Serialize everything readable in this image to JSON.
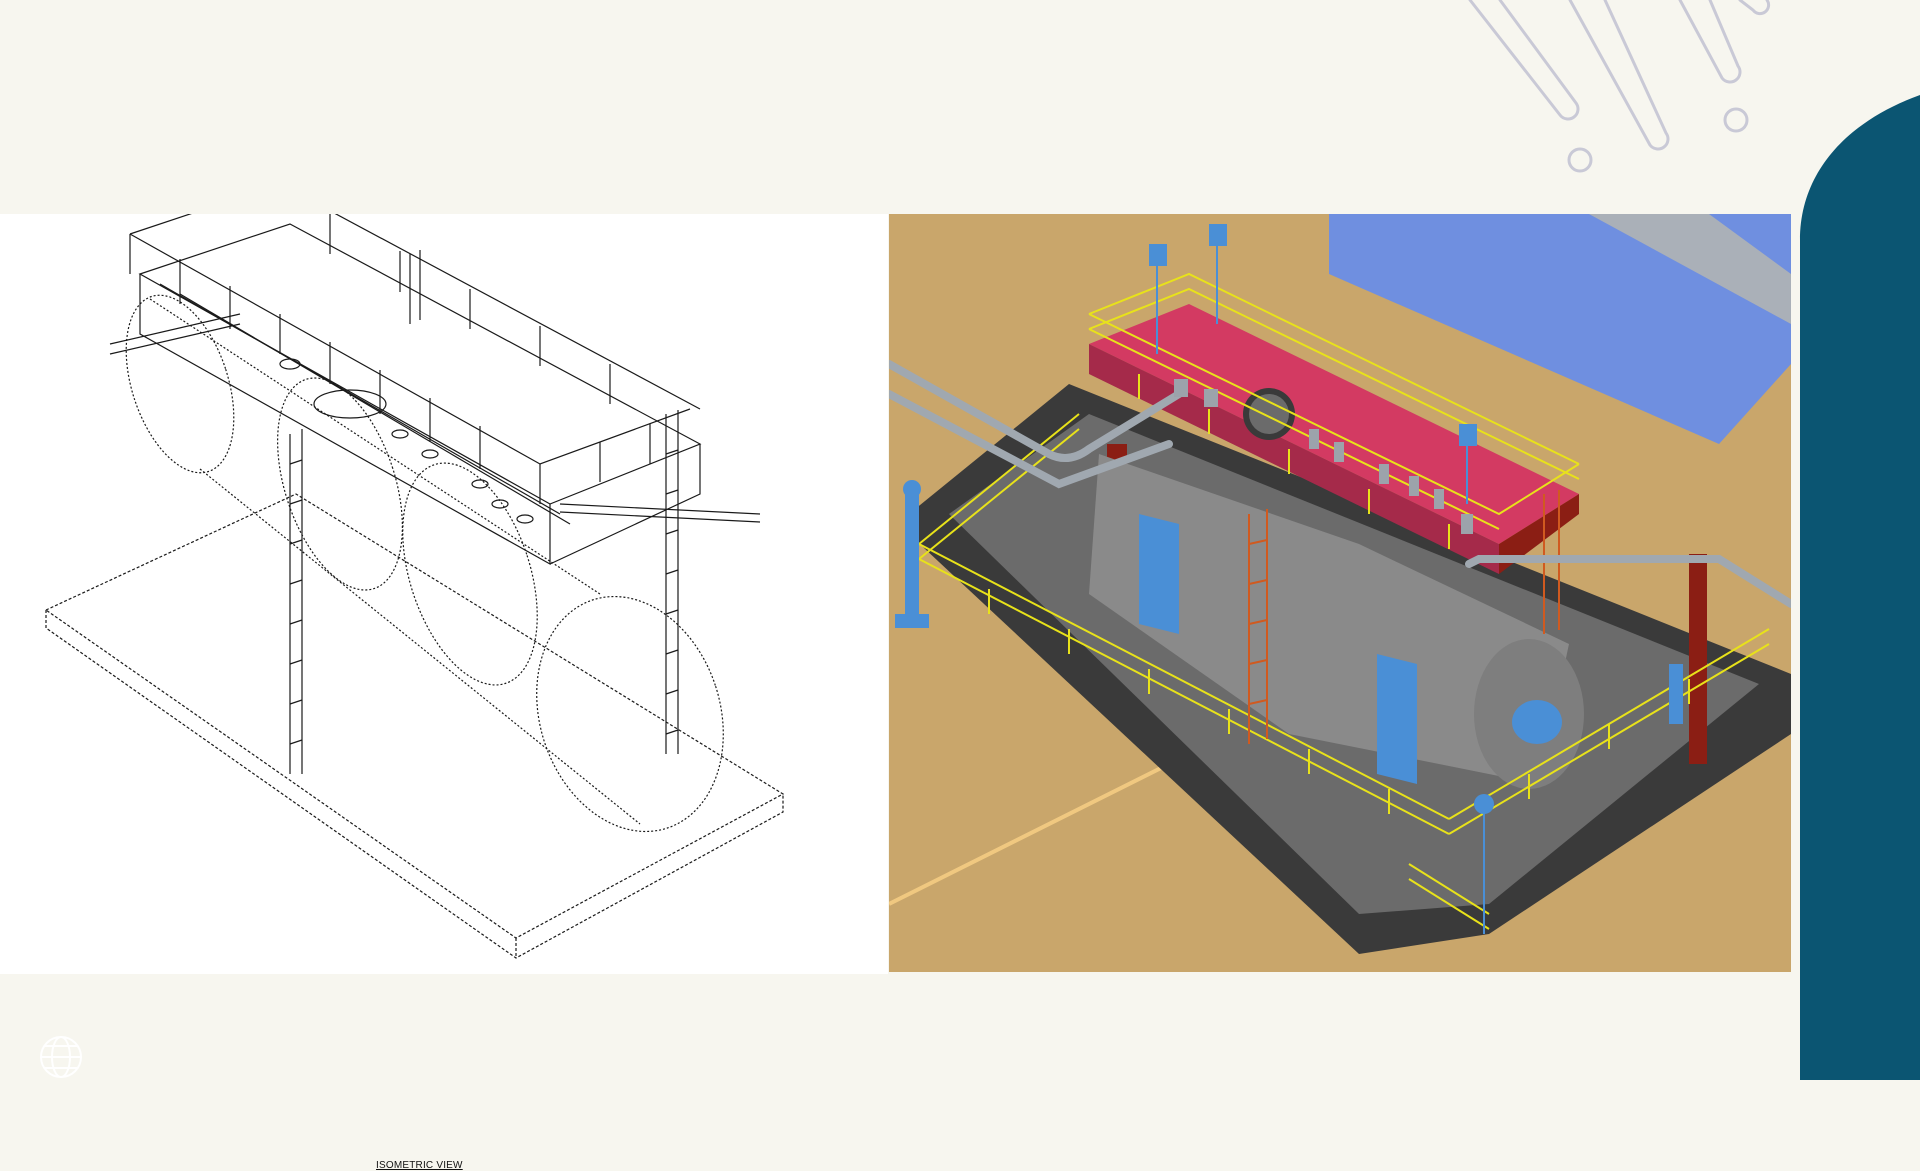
{
  "slide": {
    "background": "#f7f6ef",
    "accent": "#0b5572",
    "deco_color": "#c9c9d6"
  },
  "left_drawing": {
    "caption": "ISOMETRIC VIEW",
    "line_color": "#1a1a1a"
  },
  "right_model": {
    "ground_color": "#c9a66b",
    "water_color": "#6f8fe0",
    "platform_color": "#d33a62",
    "railing_color": "#e8e21a",
    "vessel_color": "#8a8a8a",
    "structure_color": "#8b1e14",
    "instrument_color": "#4a8fd6"
  },
  "icons": {
    "globe": "globe-icon"
  }
}
